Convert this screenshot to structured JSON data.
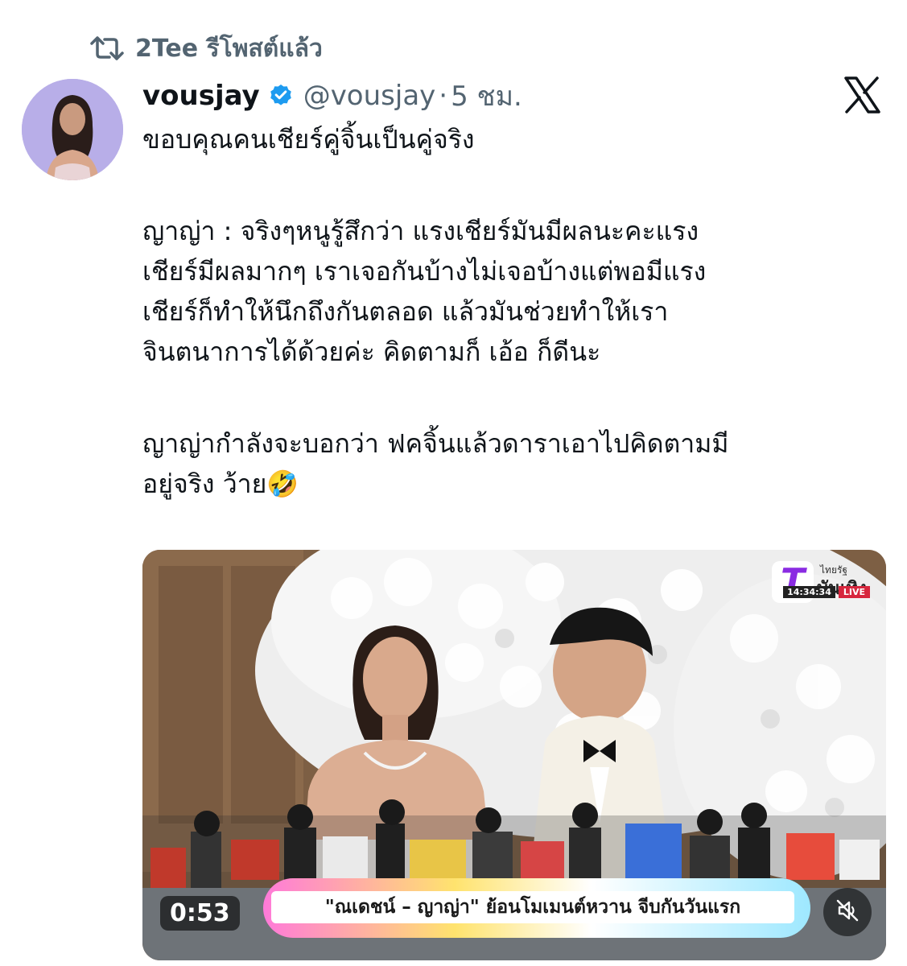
{
  "repost": {
    "icon": "repost-icon",
    "text": "2Tee รีโพสต์แล้ว"
  },
  "author": {
    "display_name": "vousjay",
    "verified": true,
    "verified_color": "#1d9bf0",
    "handle": "@vousjay",
    "separator": "·",
    "time": "5 ชม."
  },
  "platform_icon": "x-logo-icon",
  "tweet": {
    "lines_1": [
      "ขอบคุณคนเชียร์คู่จิ้นเป็นคู่จริง"
    ],
    "lines_2": [
      "ญาญ่า : จริงๆหนูรู้สึกว่า แรงเชียร์มันมีผลนะคะแรง",
      "เชียร์มีผลมากๆ เราเจอกันบ้างไม่เจอบ้างแต่พอมีแรง",
      "เชียร์ก็ทำให้นึกถึงกันตลอด แล้วมันช่วยทำให้เรา",
      "จินตนาการได้ด้วยค่ะ คิดตามก็ เอ้อ ก็ดีนะ"
    ],
    "lines_3": [
      "ญาญ่ากำลังจะบอกว่า ฟคจิ้นแล้วดาราเอาไปคิดตามมี",
      "อยู่จริง ว้าย🤣"
    ]
  },
  "video": {
    "channel_logo_mark": "T",
    "channel_name_small": "ไทยรัฐ",
    "channel_name": "บันเทิง",
    "clock": "14:34:34",
    "live_label": "LIVE",
    "caption": "\"ณเดชน์ – ญาญ่า\" ย้อนโมเมนต์หวาน จีบกันวันแรก",
    "duration": "0:53",
    "mute_icon": "speaker-muted-icon"
  }
}
